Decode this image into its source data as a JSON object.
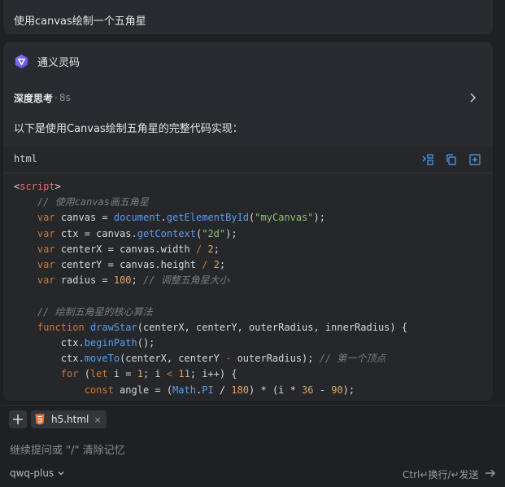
{
  "user_message": "使用canvas绘制一个五角星",
  "assistant": {
    "name": "通义灵码",
    "thinking": {
      "label": "深度思考",
      "separator": " · ",
      "duration": "8s"
    },
    "intro": "以下是使用Canvas绘制五角星的完整代码实现：",
    "code_block": {
      "language": "html",
      "tools": [
        "insert-code-icon",
        "copy-icon",
        "new-file-icon"
      ],
      "lines": [
        [
          {
            "t": "<",
            "c": "pl"
          },
          {
            "t": "script",
            "c": "tag"
          },
          {
            "t": ">",
            "c": "pl"
          }
        ],
        [
          {
            "t": "    ",
            "c": "pl"
          },
          {
            "t": "// 使用canvas画五角星",
            "c": "cm"
          }
        ],
        [
          {
            "t": "    ",
            "c": "pl"
          },
          {
            "t": "var",
            "c": "kw"
          },
          {
            "t": " canvas = ",
            "c": "pl"
          },
          {
            "t": "document",
            "c": "fn"
          },
          {
            "t": ".",
            "c": "pl"
          },
          {
            "t": "getElementById",
            "c": "fn"
          },
          {
            "t": "(",
            "c": "pl"
          },
          {
            "t": "\"myCanvas\"",
            "c": "str"
          },
          {
            "t": ");",
            "c": "pl"
          }
        ],
        [
          {
            "t": "    ",
            "c": "pl"
          },
          {
            "t": "var",
            "c": "kw"
          },
          {
            "t": " ctx = canvas.",
            "c": "pl"
          },
          {
            "t": "getContext",
            "c": "fn"
          },
          {
            "t": "(",
            "c": "pl"
          },
          {
            "t": "\"2d\"",
            "c": "str"
          },
          {
            "t": ");",
            "c": "pl"
          }
        ],
        [
          {
            "t": "    ",
            "c": "pl"
          },
          {
            "t": "var",
            "c": "kw"
          },
          {
            "t": " centerX = canvas.width ",
            "c": "pl"
          },
          {
            "t": "/",
            "c": "kw"
          },
          {
            "t": " ",
            "c": "pl"
          },
          {
            "t": "2",
            "c": "num"
          },
          {
            "t": ";",
            "c": "pl"
          }
        ],
        [
          {
            "t": "    ",
            "c": "pl"
          },
          {
            "t": "var",
            "c": "kw"
          },
          {
            "t": " centerY = canvas.height ",
            "c": "pl"
          },
          {
            "t": "/",
            "c": "kw"
          },
          {
            "t": " ",
            "c": "pl"
          },
          {
            "t": "2",
            "c": "num"
          },
          {
            "t": ";",
            "c": "pl"
          }
        ],
        [
          {
            "t": "    ",
            "c": "pl"
          },
          {
            "t": "var",
            "c": "kw"
          },
          {
            "t": " radius = ",
            "c": "pl"
          },
          {
            "t": "100",
            "c": "num"
          },
          {
            "t": "; ",
            "c": "pl"
          },
          {
            "t": "// 调整五角星大小",
            "c": "cm"
          }
        ],
        [
          {
            "t": "",
            "c": "pl"
          }
        ],
        [
          {
            "t": "    ",
            "c": "pl"
          },
          {
            "t": "// 绘制五角星的核心算法",
            "c": "cm"
          }
        ],
        [
          {
            "t": "    ",
            "c": "pl"
          },
          {
            "t": "function",
            "c": "kw"
          },
          {
            "t": " ",
            "c": "pl"
          },
          {
            "t": "drawStar",
            "c": "fn"
          },
          {
            "t": "(centerX, centerY, outerRadius, innerRadius) {",
            "c": "pl"
          }
        ],
        [
          {
            "t": "        ctx.",
            "c": "pl"
          },
          {
            "t": "beginPath",
            "c": "fn"
          },
          {
            "t": "();",
            "c": "pl"
          }
        ],
        [
          {
            "t": "        ctx.",
            "c": "pl"
          },
          {
            "t": "moveTo",
            "c": "fn"
          },
          {
            "t": "(centerX, centerY ",
            "c": "pl"
          },
          {
            "t": "-",
            "c": "kw"
          },
          {
            "t": " outerRadius); ",
            "c": "pl"
          },
          {
            "t": "// 第一个顶点",
            "c": "cm"
          }
        ],
        [
          {
            "t": "        ",
            "c": "pl"
          },
          {
            "t": "for",
            "c": "kw"
          },
          {
            "t": " (",
            "c": "pl"
          },
          {
            "t": "let",
            "c": "kw"
          },
          {
            "t": " i = ",
            "c": "pl"
          },
          {
            "t": "1",
            "c": "num"
          },
          {
            "t": "; i ",
            "c": "pl"
          },
          {
            "t": "<",
            "c": "kw"
          },
          {
            "t": " ",
            "c": "pl"
          },
          {
            "t": "11",
            "c": "num"
          },
          {
            "t": "; i++) {",
            "c": "pl"
          }
        ],
        [
          {
            "t": "            ",
            "c": "pl"
          },
          {
            "t": "const",
            "c": "kw"
          },
          {
            "t": " angle = (",
            "c": "pl"
          },
          {
            "t": "Math",
            "c": "fn"
          },
          {
            "t": ".",
            "c": "pl"
          },
          {
            "t": "PI",
            "c": "fn"
          },
          {
            "t": " / ",
            "c": "pl"
          },
          {
            "t": "180",
            "c": "num"
          },
          {
            "t": ") * (i * ",
            "c": "pl"
          },
          {
            "t": "36",
            "c": "num"
          },
          {
            "t": " - ",
            "c": "pl"
          },
          {
            "t": "90",
            "c": "num"
          },
          {
            "t": ");",
            "c": "pl"
          }
        ]
      ]
    }
  },
  "composer": {
    "attached_file": "h5.html",
    "close_glyph": "×",
    "placeholder": "继续提问或 \"/\" 清除记忆",
    "model": "qwq-plus",
    "hint": "Ctrl↵换行/↵发送"
  }
}
